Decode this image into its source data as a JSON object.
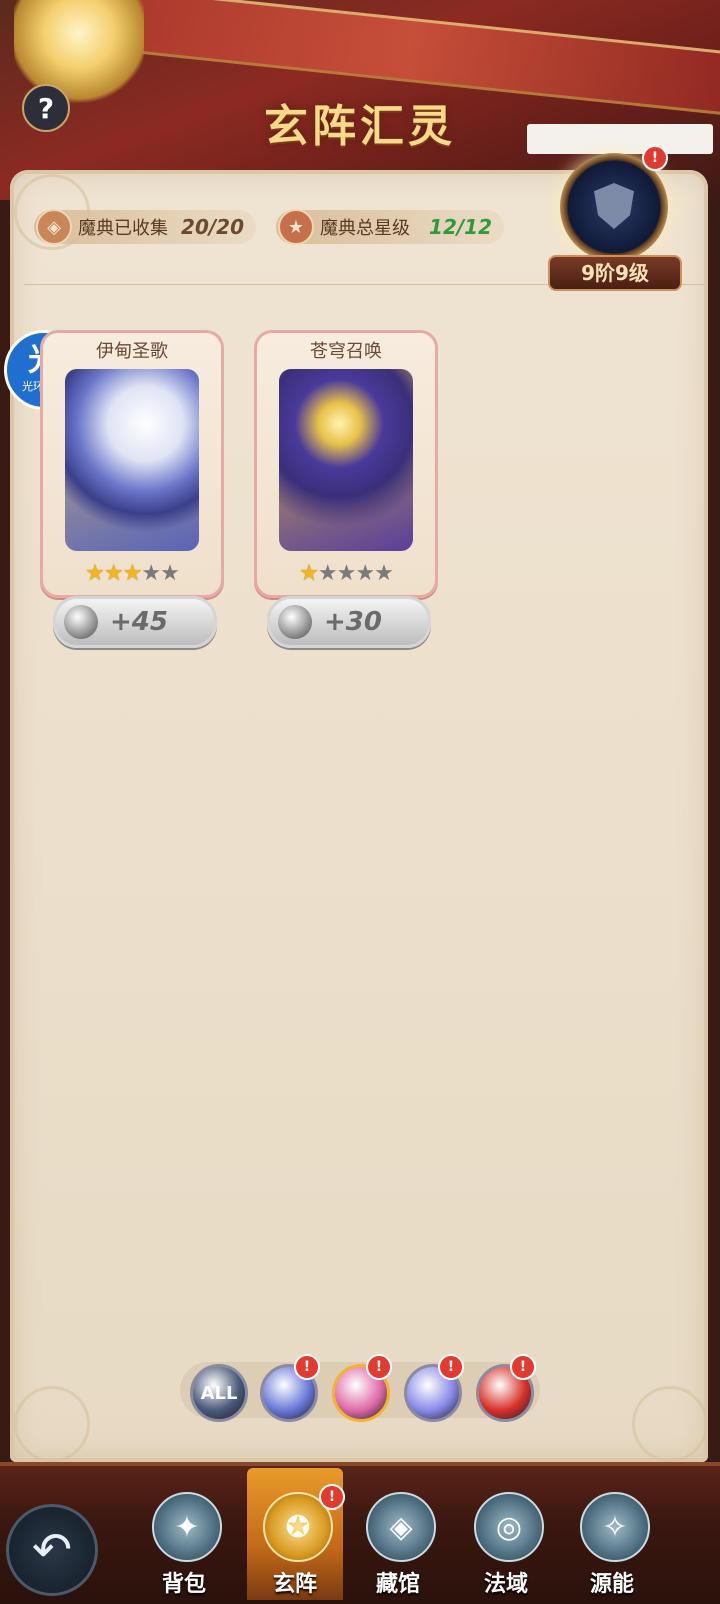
{
  "header": {
    "title": "玄阵汇灵",
    "help_label": "?"
  },
  "stats": {
    "collected_label": "魔典已收集",
    "collected_value": "20/20",
    "stars_label": "魔典总星级",
    "stars_value": "12/12"
  },
  "rank": {
    "label": "9阶9级",
    "badge": "!"
  },
  "assistant": {
    "big": "光",
    "small": "光环助手"
  },
  "books": [
    {
      "name": "伊甸圣歌",
      "stars_on": 3,
      "stars_total": 5,
      "bonus": "+45"
    },
    {
      "name": "苍穹召唤",
      "stars_on": 1,
      "stars_total": 5,
      "bonus": "+30"
    }
  ],
  "filters": [
    {
      "label": "ALL",
      "color": "#4a5a7a",
      "badge": ""
    },
    {
      "label": "",
      "color": "#6a7ad8",
      "badge": "!"
    },
    {
      "label": "",
      "color": "#e06aa8",
      "badge": "!"
    },
    {
      "label": "",
      "color": "#8a8ae8",
      "badge": "!"
    },
    {
      "label": "",
      "color": "#d8322a",
      "badge": "!"
    }
  ],
  "nav": {
    "items": [
      {
        "label": "背包",
        "icon": "✦"
      },
      {
        "label": "玄阵",
        "icon": "✪",
        "badge": "!"
      },
      {
        "label": "藏馆",
        "icon": "◈"
      },
      {
        "label": "法域",
        "icon": "◎"
      },
      {
        "label": "源能",
        "icon": "✧"
      }
    ],
    "back_icon": "↶"
  },
  "colors": {
    "accent_gold": "#f7d98a",
    "badge_red": "#e23a2e",
    "star_gold": "#f3b61d"
  }
}
